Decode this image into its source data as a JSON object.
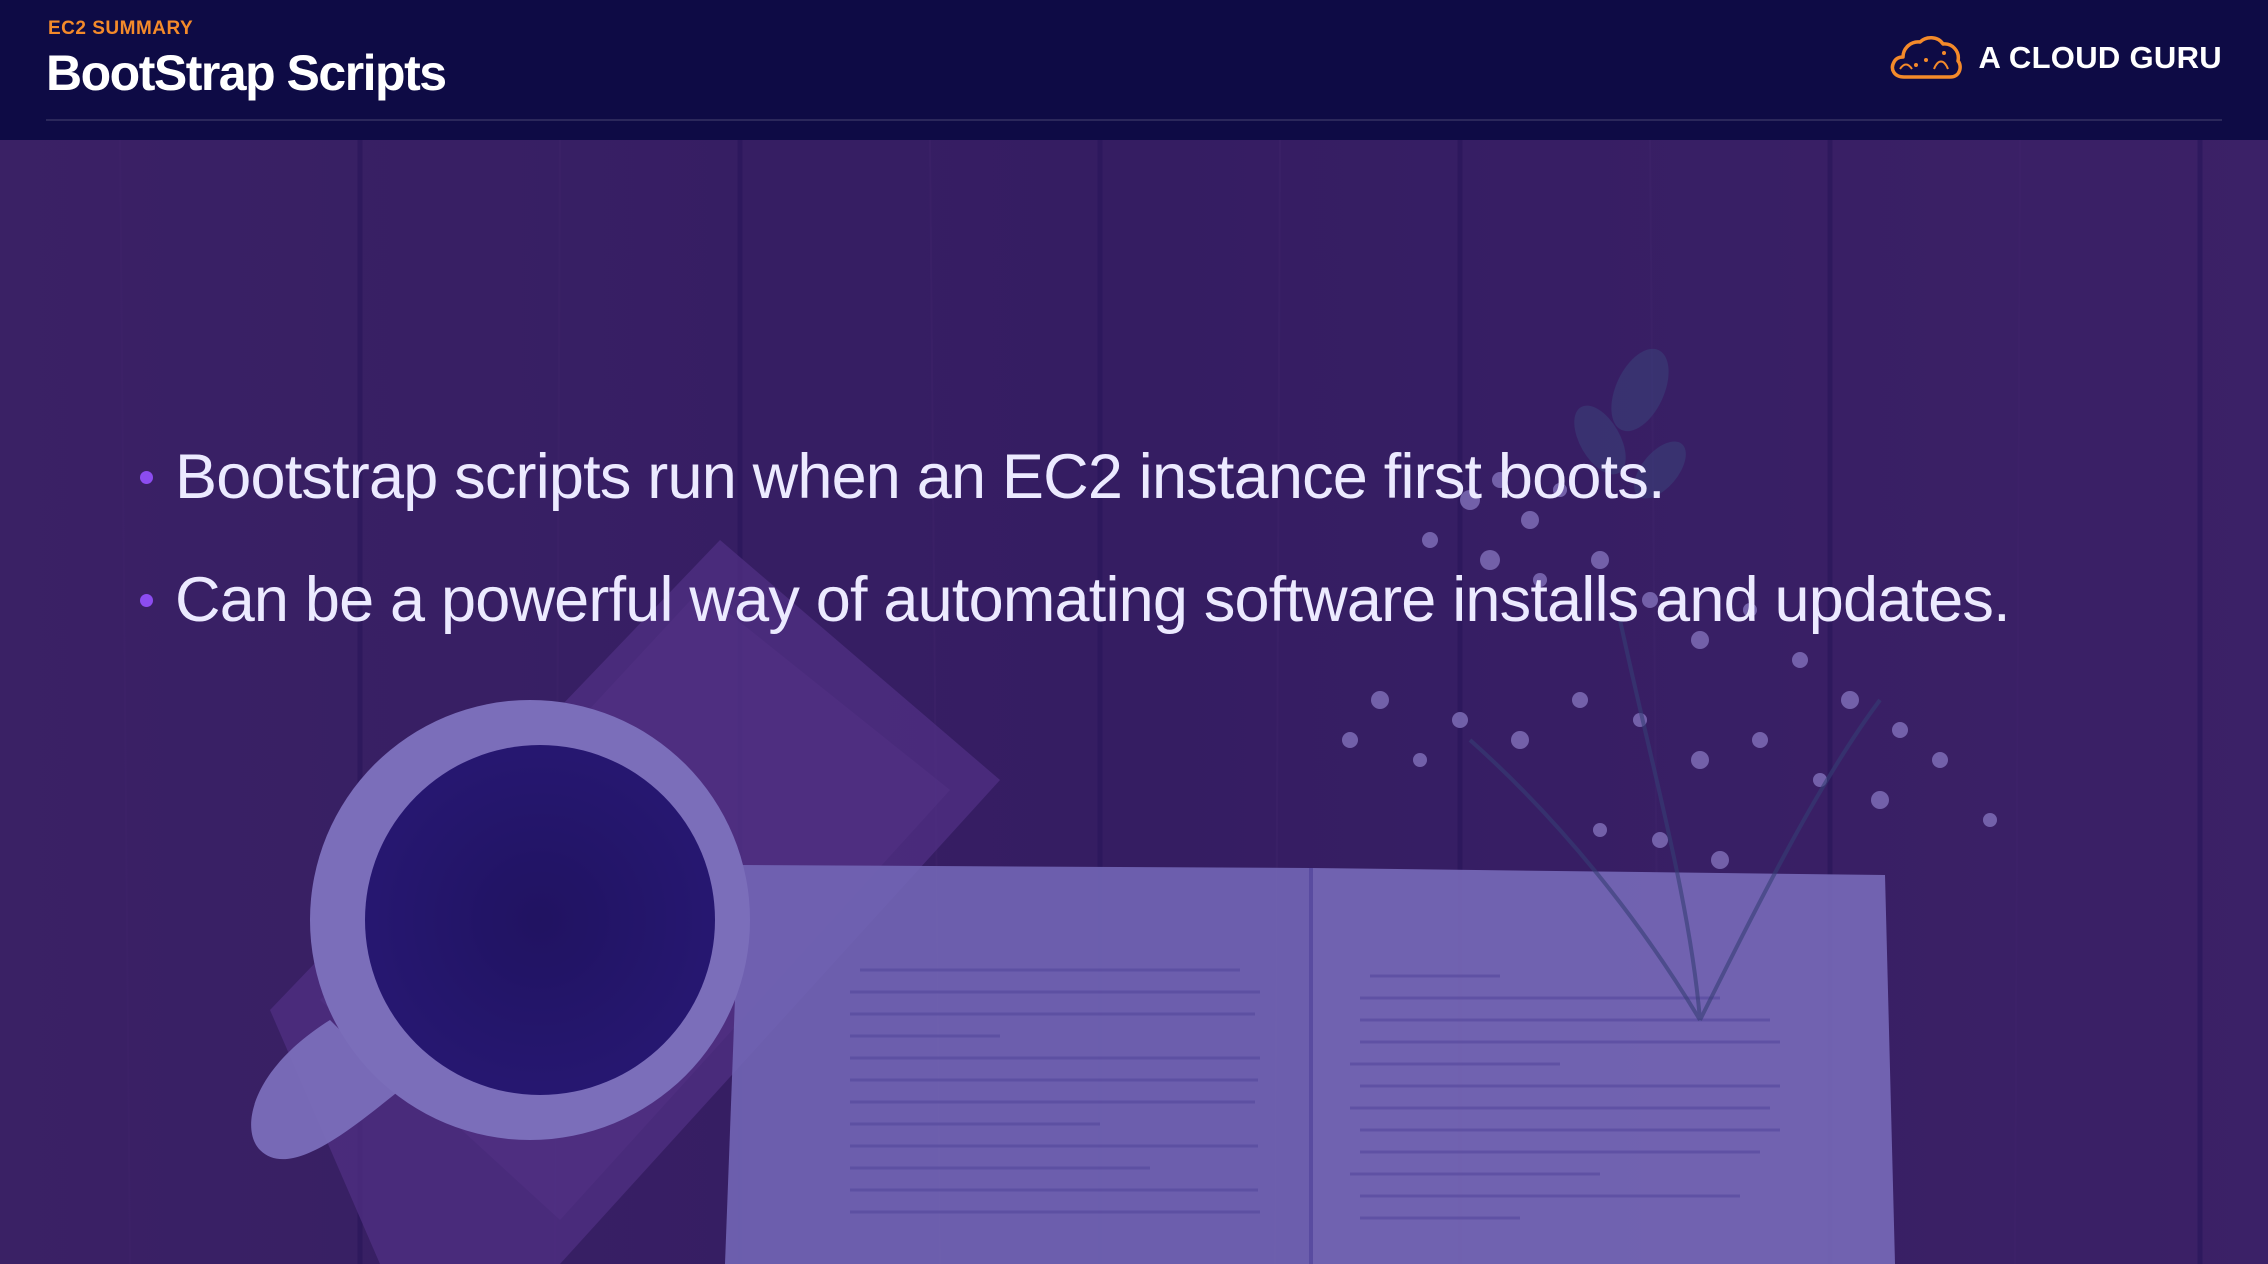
{
  "header": {
    "section_label": "EC2 SUMMARY",
    "title": "BootStrap Scripts",
    "brand": {
      "name": "A CLOUD GURU",
      "logo_icon": "cloud-logo-icon",
      "logo_color": "#f48a2a"
    }
  },
  "bullets": [
    {
      "text": "Bootstrap scripts run when an EC2 instance first boots."
    },
    {
      "text": "Can be a powerful way of automating software installs and updates."
    }
  ],
  "colors": {
    "header_background": "#0e0b45",
    "accent_orange": "#f48a2a",
    "bullet_dot": "#8c4cf0",
    "overlay_purple": "#2e1a8c",
    "text_light": "#eceaff"
  },
  "background": {
    "icon": "coffee-book-flowers-photo"
  }
}
